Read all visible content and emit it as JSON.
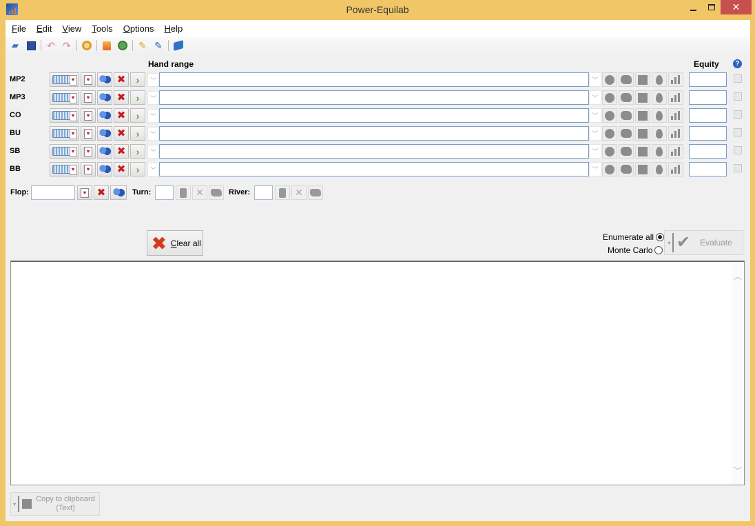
{
  "window": {
    "title": "Power-Equilab",
    "minimize_glyph": "",
    "close_glyph": "✕"
  },
  "menu": [
    {
      "label": "File",
      "mnemonic": "F"
    },
    {
      "label": "Edit",
      "mnemonic": "E"
    },
    {
      "label": "View",
      "mnemonic": "V"
    },
    {
      "label": "Tools",
      "mnemonic": "T"
    },
    {
      "label": "Options",
      "mnemonic": "O"
    },
    {
      "label": "Help",
      "mnemonic": "H"
    }
  ],
  "toolbar": {
    "open_icon": "📂",
    "save_icon": "💾",
    "undo_icon": "↶",
    "redo_icon": "↷",
    "settings_icon": "⚙",
    "fire_icon": "🔥",
    "refresh_icon": "⟳",
    "pencil_yellow_icon": "✎",
    "pencil_blue_icon": "✎",
    "book_icon": "📘"
  },
  "headers": {
    "hand_range": "Hand range",
    "equity": "Equity",
    "help": "?"
  },
  "players": [
    {
      "position": "MP2",
      "range": "",
      "equity": ""
    },
    {
      "position": "MP3",
      "range": "",
      "equity": ""
    },
    {
      "position": "CO",
      "range": "",
      "equity": ""
    },
    {
      "position": "BU",
      "range": "",
      "equity": ""
    },
    {
      "position": "SB",
      "range": "",
      "equity": ""
    },
    {
      "position": "BB",
      "range": "",
      "equity": ""
    }
  ],
  "board": {
    "flop_label": "Flop:",
    "flop_value": "",
    "turn_label": "Turn:",
    "turn_value": "",
    "river_label": "River:",
    "river_value": ""
  },
  "actions": {
    "clear_all": "Clear all",
    "clear_all_mnemonic": "C",
    "enumerate_all": "Enumerate all",
    "monte_carlo": "Monte Carlo",
    "selected_mode": "enumerate_all",
    "evaluate": "Evaluate",
    "copy_line1": "Copy to clipboard",
    "copy_line2": "(Text)"
  },
  "results": {
    "text": ""
  }
}
